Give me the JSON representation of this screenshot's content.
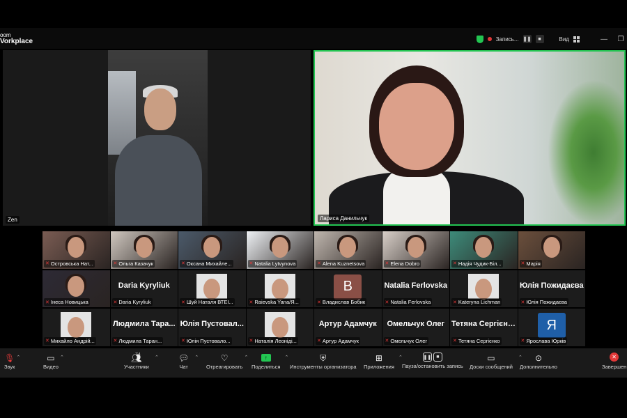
{
  "app": {
    "brand_line1": "oom",
    "brand_line2": "Vorkplace"
  },
  "topbar": {
    "recording_label": "Запись...",
    "view_label": "Вид"
  },
  "speakers": {
    "left_name": "Zen",
    "right_name": "Лариса Данильчук"
  },
  "gallery": [
    {
      "name": "Островська Нат...",
      "kind": "video",
      "bg": "#7a5c53"
    },
    {
      "name": "Ольга Казачук",
      "kind": "video",
      "bg": "#cfc7bf"
    },
    {
      "name": "Оксана Михайле...",
      "kind": "video",
      "bg": "#4b5a6a"
    },
    {
      "name": "Natalia Lytvynova",
      "kind": "video",
      "bg": "#eef1f4"
    },
    {
      "name": "Alena Kuznetsova",
      "kind": "video",
      "bg": "#bfb6ae"
    },
    {
      "name": "Elena Dobro",
      "kind": "video",
      "bg": "#d8cfc8"
    },
    {
      "name": "Надія Чудик-Біл...",
      "kind": "video",
      "bg": "#3d8b7a"
    },
    {
      "name": "Марія",
      "kind": "video",
      "bg": "#6b4f3c"
    },
    {
      "name": "Інеса Новицька",
      "kind": "video",
      "bg": "#2d2a35"
    },
    {
      "name": "Daria Kyryliuk",
      "kind": "name",
      "big": "Daria Kyryliuk"
    },
    {
      "name": "Шуй Наталя ВТЕІ...",
      "kind": "photo"
    },
    {
      "name": "Raievska Yana/Я...",
      "kind": "photo"
    },
    {
      "name": "Владислав Бобик",
      "kind": "avatar",
      "letter": "B",
      "color": "#8a4f46"
    },
    {
      "name": "Natalia Ferlovska",
      "kind": "name",
      "big": "Natalia Ferlovska"
    },
    {
      "name": "Kateryna Lichman",
      "kind": "photo"
    },
    {
      "name": "Юлія Пожидаєва",
      "kind": "name",
      "big": "Юлія Пожидаєва"
    },
    {
      "name": "Михайло Андрій...",
      "kind": "photo"
    },
    {
      "name": "Людмила Таран...",
      "kind": "name",
      "big": "Людмила Тара..."
    },
    {
      "name": "Юлія Пустовало...",
      "kind": "name",
      "big": "Юлія Пустовал..."
    },
    {
      "name": "Наталія Леоніді...",
      "kind": "photo"
    },
    {
      "name": "Артур Адамчук",
      "kind": "name",
      "big": "Артур Адамчук"
    },
    {
      "name": "Омельчук Олег",
      "kind": "name",
      "big": "Омельчук Олег"
    },
    {
      "name": "Тетяна Сергієнко",
      "kind": "name",
      "big": "Тетяна Сергієнко"
    },
    {
      "name": "Ярослава Юрків",
      "kind": "avatar",
      "letter": "Я",
      "color": "#1f5fa8"
    }
  ],
  "toolbar": {
    "audio": "Звук",
    "video": "Видео",
    "participants": "Участники",
    "participants_count": "74",
    "chat": "Чат",
    "react": "Отреагировать",
    "share": "Поделиться",
    "host_tools": "Инструменты организатора",
    "apps": "Приложения",
    "pause_record": "Пауза/остановить запись",
    "whiteboards": "Доски сообщений",
    "more": "Дополнительно",
    "end": "Завершен"
  },
  "colors": {
    "active_speaker": "#23c552",
    "mute": "#e23838",
    "share": "#23c552"
  }
}
